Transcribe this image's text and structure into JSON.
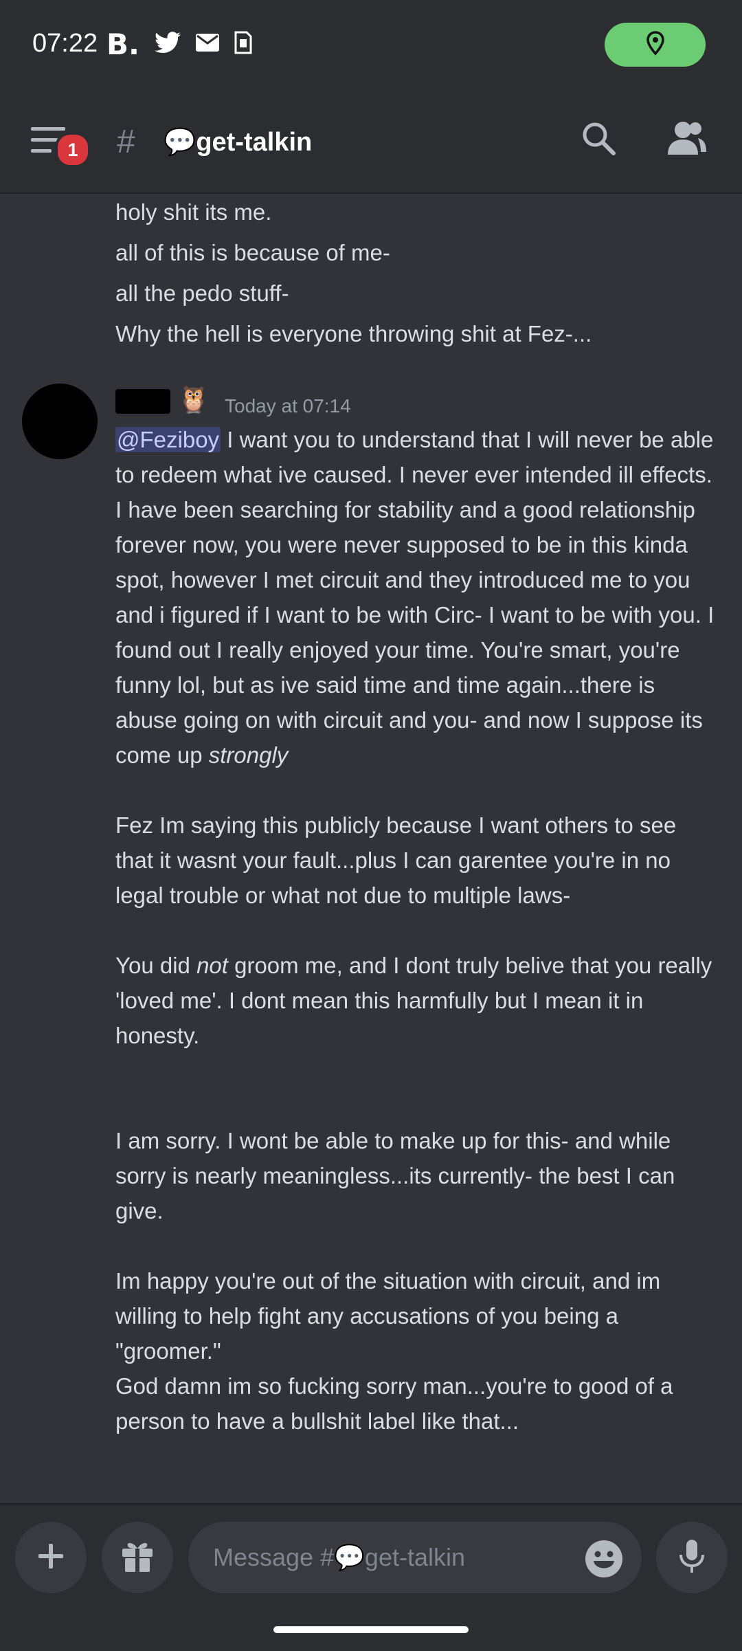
{
  "status_bar": {
    "time": "07:22",
    "b_label": "B.",
    "icons": [
      "twitter-icon",
      "mail-icon",
      "sim-card-icon",
      "location-pin-icon"
    ],
    "location_pill_color": "#6ccc74"
  },
  "header": {
    "notification_count": "1",
    "hash": "#",
    "channel_name": "💬get-talkin"
  },
  "prior_lines": [
    "holy shit its me.",
    "all of this is because of me-",
    "all the pedo stuff-",
    "Why the hell is everyone throwing shit at Fez-..."
  ],
  "message": {
    "emoji": "🦉",
    "timestamp": "Today at 07:14",
    "mention": "@Feziboy",
    "p1_after_mention": " I want you to understand that I will never be able to redeem what ive caused. I never ever intended ill effects. I have been searching for stability and a good relationship forever now, you were never supposed to be in this kinda spot, however I met circuit and they introduced me to you and i figured if I want to be with Circ- I want to be with you. I found out I really enjoyed your time. You're smart, you're funny lol, but as ive said time and time again...there is abuse going on with circuit and you- and now I suppose its come up ",
    "p1_italic": "strongly",
    "p2": "Fez Im saying this publicly because I want others to see that it wasnt your fault...plus I can garentee you're in no legal trouble or what not due to multiple laws-",
    "p3_start": "You did ",
    "p3_italic": "not",
    "p3_rest": " groom me, and I dont truly belive that you really 'loved me'. I dont mean this harmfully but I mean it in honesty.",
    "p4": "I am sorry. I wont be able to make up for this- and while sorry is nearly meaningless...its currently- the best I can give.",
    "p5": "Im happy you're out of the situation with circuit, and im willing to help fight any accusations of you being a \"groomer.\"",
    "p6": "God damn im so fucking sorry man...you're to good of a person to have a bullshit label like that..."
  },
  "composer": {
    "placeholder": "Message #💬get-talkin"
  },
  "colors": {
    "background": "#313338",
    "bars": "#2b2d31",
    "mention_bg": "#3c4270",
    "badge": "#da373c"
  }
}
